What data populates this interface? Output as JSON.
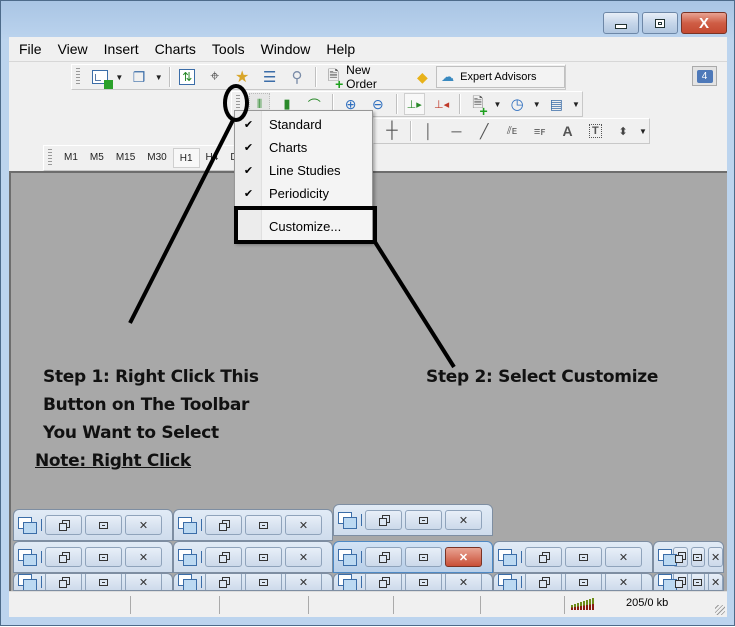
{
  "window": {
    "controls": {
      "minimize": "minimize",
      "maximize": "maximize",
      "close": "X"
    }
  },
  "menubar": {
    "items": [
      "File",
      "View",
      "Insert",
      "Charts",
      "Tools",
      "Window",
      "Help"
    ]
  },
  "toolbars": {
    "standard": {
      "buttons": [
        "new-chart",
        "profiles",
        "market-watch",
        "data-window",
        "navigator",
        "terminal",
        "strategy-tester"
      ],
      "new_order_label": "New Order",
      "expert_advisors_label": "Expert Advisors",
      "notification_count": "4"
    },
    "charts": {
      "buttons": [
        "bar-chart",
        "candlesticks",
        "line-chart",
        "zoom-in",
        "zoom-out",
        "auto-scroll",
        "chart-shift",
        "indicators",
        "periods",
        "templates"
      ]
    },
    "line_studies": {
      "buttons": [
        "crosshair",
        "vertical-line",
        "horizontal-line",
        "trendline",
        "equidistant-channel",
        "fibonacci",
        "text",
        "text-label",
        "arrows"
      ]
    },
    "periodicity": {
      "periods": [
        "M1",
        "M5",
        "M15",
        "M30",
        "H1",
        "H4",
        "D1"
      ],
      "active": "H1"
    }
  },
  "context_menu": {
    "items": [
      {
        "label": "Standard",
        "checked": true
      },
      {
        "label": "Charts",
        "checked": true
      },
      {
        "label": "Line Studies",
        "checked": true
      },
      {
        "label": "Periodicity",
        "checked": true
      }
    ],
    "customize_label": "Customize...",
    "check_glyph": "✔"
  },
  "annotations": {
    "step1": [
      "Step 1: Right Click This",
      "Button on The Toolbar",
      "You Want to Select"
    ],
    "note": "Note: Right Click",
    "step2": "Step 2: Select Customize"
  },
  "mdi_tabs": {
    "close_glyph": "✕"
  },
  "statusbar": {
    "traffic": "205/0 kb"
  }
}
